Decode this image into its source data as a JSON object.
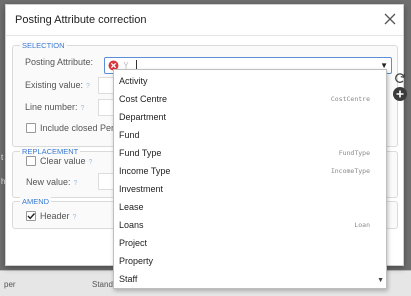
{
  "background": {
    "table_cells": [
      "per",
      "Stand"
    ],
    "slivers": [
      "t",
      "h"
    ]
  },
  "dialog": {
    "title": "Posting Attribute correction"
  },
  "selection": {
    "legend": "SELECTION",
    "posting_attribute_label": "Posting Attribute:",
    "existing_value_label": "Existing value:",
    "line_number_label": "Line number:",
    "include_closed_label": "Include closed Perio"
  },
  "replacement": {
    "legend": "REPLACEMENT",
    "clear_value_label": "Clear value",
    "new_value_label": "New value:"
  },
  "amend": {
    "legend": "AMEND",
    "header_label": "Header",
    "header_checked": true
  },
  "combo": {
    "value": ""
  },
  "dropdown": {
    "items": [
      {
        "name": "Activity",
        "code": ""
      },
      {
        "name": "Cost Centre",
        "code": "CostCentre"
      },
      {
        "name": "Department",
        "code": ""
      },
      {
        "name": "Fund",
        "code": ""
      },
      {
        "name": "Fund Type",
        "code": "FundType"
      },
      {
        "name": "Income Type",
        "code": "IncomeType"
      },
      {
        "name": "Investment",
        "code": ""
      },
      {
        "name": "Lease",
        "code": ""
      },
      {
        "name": "Loans",
        "code": "Loan"
      },
      {
        "name": "Project",
        "code": ""
      },
      {
        "name": "Property",
        "code": ""
      },
      {
        "name": "Staff",
        "code": ""
      }
    ]
  },
  "colors": {
    "accent": "#3a7bd5",
    "clear_icon": "#d9363e",
    "add_button": "#3a3a3a"
  },
  "icons": [
    "close-icon",
    "clear-icon",
    "search-icon",
    "chevron-down-icon",
    "refresh-icon",
    "plus-icon",
    "help-icon",
    "checkmark-icon"
  ]
}
